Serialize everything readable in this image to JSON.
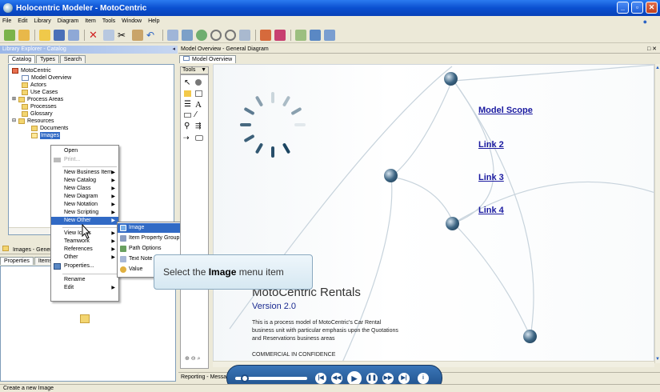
{
  "window": {
    "title": "Holocentric Modeler - MotoCentric"
  },
  "menubar": [
    "File",
    "Edit",
    "Library",
    "Diagram",
    "Item",
    "Tools",
    "Window",
    "Help"
  ],
  "library_explorer": {
    "title": "Library Explorer - Catalog",
    "tabs": [
      "Catalog",
      "Types",
      "Search"
    ],
    "tree": [
      {
        "label": "MotoCentric",
        "kind": "folder-red"
      },
      {
        "label": "Model Overview",
        "kind": "diagram"
      },
      {
        "label": "Actors",
        "kind": "folder"
      },
      {
        "label": "Use Cases",
        "kind": "folder"
      },
      {
        "label": "Process Areas",
        "kind": "folder"
      },
      {
        "label": "Processes",
        "kind": "folder"
      },
      {
        "label": "Glossary",
        "kind": "folder"
      },
      {
        "label": "Resources",
        "kind": "folder"
      },
      {
        "label": "Documents",
        "kind": "folder"
      },
      {
        "label": "Images",
        "kind": "folder-open",
        "selected": true
      }
    ]
  },
  "context_menu": {
    "items": [
      {
        "label": "Open"
      },
      {
        "label": "Print...",
        "disabled": true
      },
      {
        "label": "New Business Item",
        "submenu": true
      },
      {
        "label": "New Catalog",
        "submenu": true
      },
      {
        "label": "New Class",
        "submenu": true
      },
      {
        "label": "New Diagram",
        "submenu": true
      },
      {
        "label": "New Notation",
        "submenu": true
      },
      {
        "label": "New Scripting",
        "submenu": true
      },
      {
        "label": "New Other",
        "submenu": true,
        "highlighted": true
      },
      {
        "label": "View Icons",
        "submenu": true
      },
      {
        "label": "Teamwork",
        "submenu": true
      },
      {
        "label": "References",
        "submenu": true
      },
      {
        "label": "Other",
        "submenu": true
      },
      {
        "label": "Properties..."
      },
      {
        "label": "Rename"
      },
      {
        "label": "Edit",
        "submenu": true
      }
    ]
  },
  "submenu": {
    "items": [
      {
        "label": "Image",
        "highlighted": true
      },
      {
        "label": "Item Property Group"
      },
      {
        "label": "Path Options"
      },
      {
        "label": "Text Note"
      },
      {
        "label": "Value"
      }
    ]
  },
  "callout": {
    "prefix": "Select the ",
    "bold": "Image",
    "suffix": " menu item"
  },
  "bottom_panel": {
    "title": "Images - General",
    "tabs": [
      "Properties",
      "Items"
    ]
  },
  "diagram": {
    "panel_title": "Model Overview - General Diagram",
    "tab": "Model Overview",
    "tools_label": "Tools",
    "links": [
      "Model Scope",
      "Link 2",
      "Link 3",
      "Link 4"
    ],
    "heading": "MotoCentric Rentals",
    "version": "Version 2.0",
    "description": "This is a process model of MotoCentric's Car Rental business unit with particular emphasis upon the Quotations and Reservations business areas",
    "confidential": "COMMERCIAL IN CONFIDENCE",
    "reporting_label": "Reporting - Messages"
  },
  "statusbar": {
    "text": "Create a new Image"
  },
  "colors": {
    "titlebar": "#0a4fd0",
    "selection": "#316ac5",
    "link": "#1a1aa0",
    "player": "#1c4c86"
  }
}
